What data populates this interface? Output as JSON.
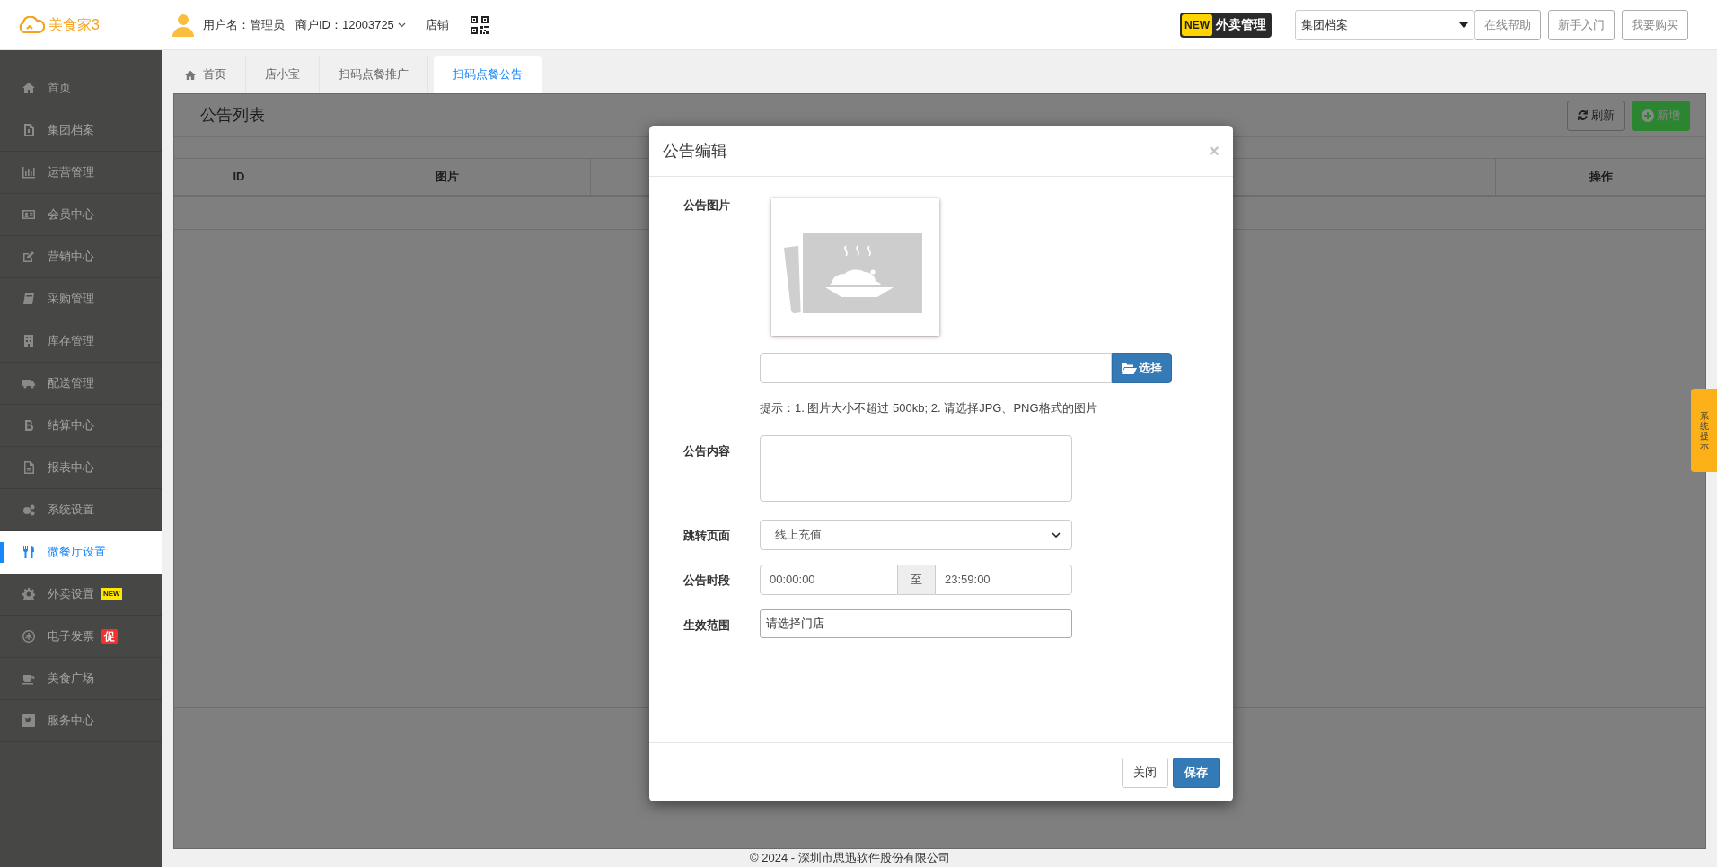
{
  "header": {
    "logo": "美食家3",
    "username": "用户名：管理员",
    "merchant_id": "商户ID：12003725",
    "store": "店铺",
    "promo_badge": {
      "tag": "NEW",
      "label": "外卖管理"
    },
    "group_select": "集团档案",
    "buttons": [
      "在线帮助",
      "新手入门",
      "我要购买"
    ]
  },
  "sidebar": {
    "items": [
      {
        "label": "首页",
        "selected": false
      },
      {
        "label": "集团档案",
        "selected": false
      },
      {
        "label": "运营管理",
        "selected": false
      },
      {
        "label": "会员中心",
        "selected": false
      },
      {
        "label": "营销中心",
        "selected": false
      },
      {
        "label": "采购管理",
        "selected": false
      },
      {
        "label": "库存管理",
        "selected": false
      },
      {
        "label": "配送管理",
        "selected": false
      },
      {
        "label": "结算中心",
        "selected": false
      },
      {
        "label": "报表中心",
        "selected": false
      },
      {
        "label": "系统设置",
        "selected": false
      },
      {
        "label": "微餐厅设置",
        "selected": true
      },
      {
        "label": "外卖设置",
        "selected": false,
        "badge": {
          "text": "NEW",
          "kind": "new"
        }
      },
      {
        "label": "电子发票",
        "selected": false,
        "badge": {
          "text": "促",
          "kind": "promo"
        }
      },
      {
        "label": "美食广场",
        "selected": false
      },
      {
        "label": "服务中心",
        "selected": false
      }
    ]
  },
  "tabs": [
    {
      "label": "首页",
      "selected": false
    },
    {
      "label": "店小宝",
      "selected": false
    },
    {
      "label": "扫码点餐推广",
      "selected": false
    },
    {
      "label": "扫码点餐公告",
      "selected": true
    }
  ],
  "panel": {
    "title": "公告列表",
    "buttons": [
      {
        "label": "刷新",
        "kind": "refresh"
      },
      {
        "label": "新增",
        "kind": "add"
      }
    ],
    "table": {
      "columns": [
        "ID",
        "图片",
        "操作"
      ]
    }
  },
  "modal": {
    "title": "公告编辑",
    "close": "×",
    "fields": [
      {
        "kind": "image",
        "label": "公告图片",
        "button": "选择",
        "hint": "提示：1. 图片大小不超过 500kb; 2. 请选择JPG、PNG格式的图片"
      },
      {
        "kind": "textarea",
        "label": "公告内容"
      },
      {
        "kind": "select",
        "label": "跳转页面",
        "value": "线上充值"
      },
      {
        "kind": "time_range",
        "label": "公告时段",
        "start": "00:00:00",
        "separator": "至",
        "end": "23:59:00"
      },
      {
        "kind": "text",
        "label": "生效范围",
        "value": "请选择门店"
      }
    ],
    "buttons": [
      {
        "label": "关闭",
        "kind": "default"
      },
      {
        "label": "保存",
        "kind": "primary"
      }
    ]
  },
  "side_tab": "系统提示",
  "footer": "© 2024 - 深圳市思迅软件股份有限公司"
}
